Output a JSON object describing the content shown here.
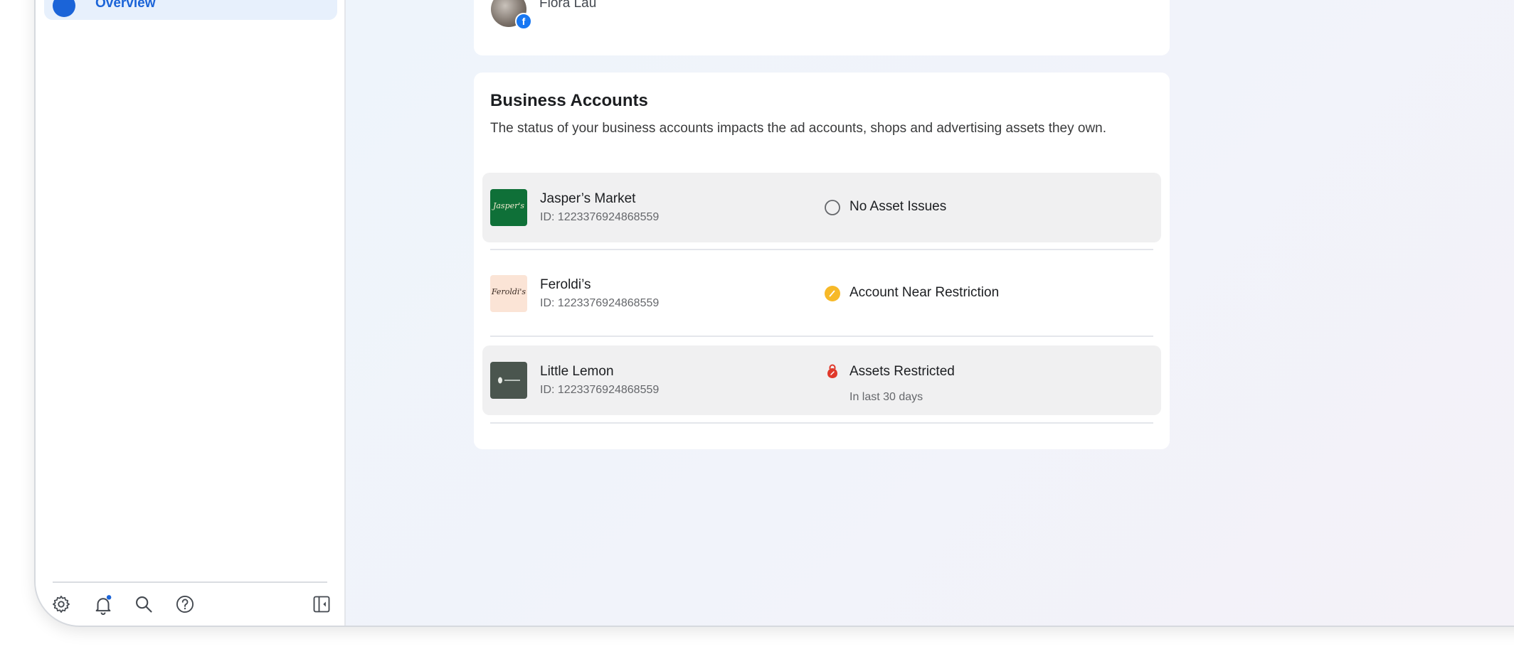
{
  "sidebar": {
    "active_item": {
      "label": "Overview",
      "icon": "overview-icon"
    },
    "bottom_icons": [
      "settings-icon",
      "notifications-icon",
      "search-icon",
      "help-icon",
      "panel-toggle-icon"
    ]
  },
  "profile": {
    "name": "Flora Lau",
    "badge": "f"
  },
  "business_accounts": {
    "title": "Business Accounts",
    "description": "The status of your business accounts impacts the ad accounts, shops and advertising assets they own.",
    "accounts": [
      {
        "name": "Jasper’s Market",
        "id": "ID: 1223376924868559",
        "status": "No Asset Issues",
        "status_sub": "",
        "logo_text": "Jasper's",
        "logo_bg": "#0f7038"
      },
      {
        "name": "Feroldi’s",
        "id": "ID: 1223376924868559",
        "status": "Account Near Restriction",
        "status_sub": "",
        "logo_text": "Feroldi's",
        "logo_bg": "#fbe4d6"
      },
      {
        "name": "Little Lemon",
        "id": "ID: 1223376924868559",
        "status": "Assets Restricted",
        "status_sub": "In last 30 days",
        "logo_text": "",
        "logo_bg": "#4a554e"
      }
    ]
  },
  "colors": {
    "accent": "#1b64d8",
    "warning": "#f7b928",
    "danger": "#e0382a"
  }
}
